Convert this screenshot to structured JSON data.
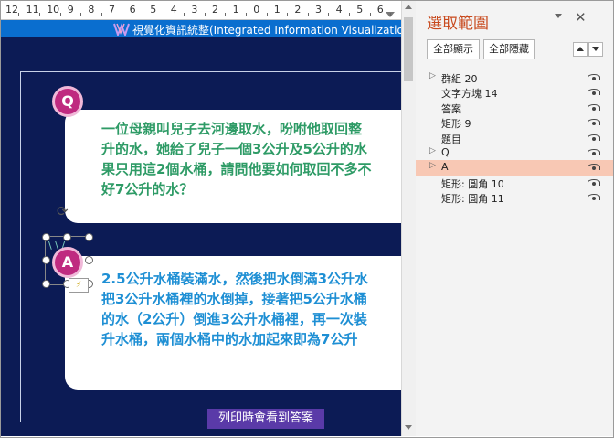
{
  "ruler": {
    "numbers": [
      "12",
      "11",
      "10",
      "9",
      "8",
      "7",
      "6",
      "5",
      "4",
      "3",
      "2",
      "1",
      "0",
      "1",
      "2",
      "3",
      "4",
      "5",
      "6"
    ]
  },
  "slide": {
    "header_title": "視覺化資訊統整(Integrated Information Visualizatio",
    "q_badge": "Q",
    "a_badge": "A",
    "question_lines": [
      "一位母親叫兒子去河邊取水，吩咐他取回整",
      "升的水，她給了兒子一個3公升及5公升的水",
      "果只用這2個水桶，請問他要如何取回不多不",
      "好7公升的水？"
    ],
    "answer_lines": [
      "2.5公升水桶裝滿水，然後把水倒滿3公升水",
      "把3公升水桶裡的水倒掉，接著把5公升水桶",
      "的水（2公升）倒進3公升水桶裡，再一次裝",
      "升水桶，兩個水桶中的水加起來即為7公升"
    ],
    "footer_label": "列印時會看到答案",
    "colors": {
      "background": "#0c1b55",
      "header": "#0a6ecf",
      "question_text": "#2e9b66",
      "answer_text": "#1e8fd4",
      "badge": "#bf2a80",
      "footer": "#5a3aa8"
    }
  },
  "pane": {
    "title": "選取範圍",
    "show_all": "全部顯示",
    "hide_all": "全部隱藏",
    "items": [
      {
        "label": "群組 20",
        "expandable": true,
        "selected": false
      },
      {
        "label": "文字方塊 14",
        "expandable": false,
        "selected": false
      },
      {
        "label": "答案",
        "expandable": false,
        "selected": false
      },
      {
        "label": "矩形 9",
        "expandable": false,
        "selected": false
      },
      {
        "label": "題目",
        "expandable": false,
        "selected": false
      },
      {
        "label": "Q",
        "expandable": true,
        "selected": false
      },
      {
        "label": "A",
        "expandable": true,
        "selected": true
      },
      {
        "label": "矩形: 圓角 10",
        "expandable": false,
        "selected": false
      },
      {
        "label": "矩形: 圓角 11",
        "expandable": false,
        "selected": false
      }
    ],
    "accent_color": "#c84a1e",
    "selected_color": "#f8c8b4"
  }
}
